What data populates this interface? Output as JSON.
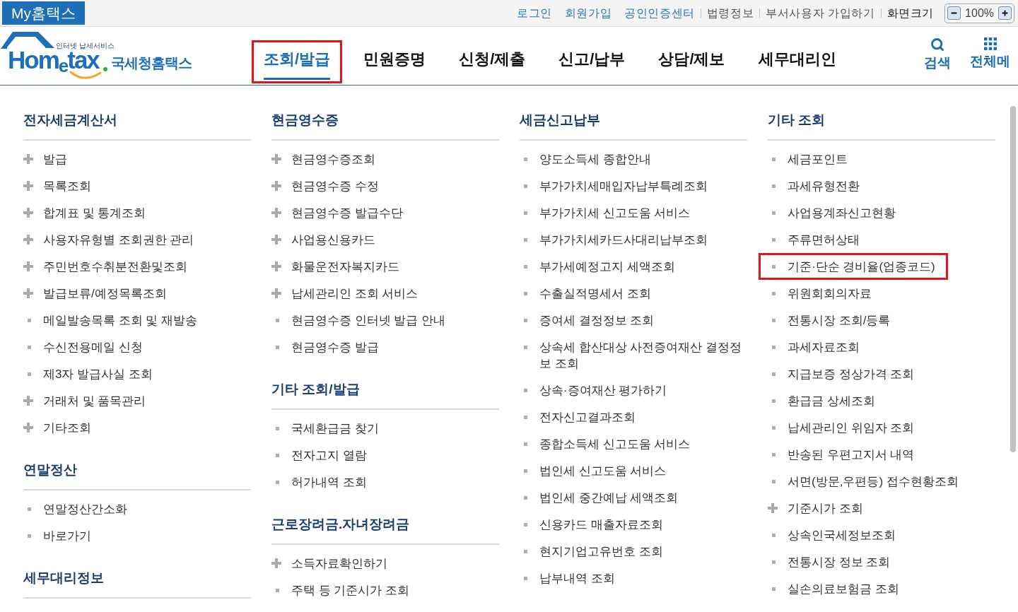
{
  "top_bar": {
    "brand": "My홈택스",
    "links": [
      {
        "label": "로그인",
        "kind": "primary"
      },
      {
        "label": "회원가입",
        "kind": "primary"
      },
      {
        "label": "공인인증센터",
        "kind": "primary"
      },
      {
        "label": "법령정보",
        "kind": "secondary"
      },
      {
        "label": "부서사용자 가입하기",
        "kind": "secondary"
      },
      {
        "label": "화면크기",
        "kind": "label"
      }
    ],
    "zoom_level": "100%"
  },
  "header": {
    "logo": {
      "tagline": "인터넷 납세서비스",
      "wordmark": "Hom$_{e}$tax",
      "title": "국세청홈택스"
    },
    "nav": [
      {
        "label": "조회/발급",
        "selected": true,
        "highlighted": true
      },
      {
        "label": "민원증명",
        "selected": false,
        "highlighted": false
      },
      {
        "label": "신청/제출",
        "selected": false,
        "highlighted": false
      },
      {
        "label": "신고/납부",
        "selected": false,
        "highlighted": false
      },
      {
        "label": "상담/제보",
        "selected": false,
        "highlighted": false
      },
      {
        "label": "세무대리인",
        "selected": false,
        "highlighted": false
      }
    ],
    "tools": [
      {
        "label": "검색",
        "kind": "search"
      },
      {
        "label": "전체메",
        "kind": "menu"
      }
    ]
  },
  "menu": {
    "columns": [
      {
        "sections": [
          {
            "title": "전자세금계산서",
            "items": [
              {
                "label": "발급",
                "kind": "expand",
                "highlighted": false
              },
              {
                "label": "목록조회",
                "kind": "expand",
                "highlighted": false
              },
              {
                "label": "합계표 및 통계조회",
                "kind": "expand",
                "highlighted": false
              },
              {
                "label": "사용자유형별 조회권한 관리",
                "kind": "expand",
                "highlighted": false
              },
              {
                "label": "주민번호수취분전환및조회",
                "kind": "expand",
                "highlighted": false
              },
              {
                "label": "발급보류/예정목록조회",
                "kind": "expand",
                "highlighted": false
              },
              {
                "label": "메일발송목록 조회 및 재발송",
                "kind": "link",
                "highlighted": false
              },
              {
                "label": "수신전용메일 신청",
                "kind": "link",
                "highlighted": false
              },
              {
                "label": "제3자 발급사실 조회",
                "kind": "link",
                "highlighted": false
              },
              {
                "label": "거래처 및 품목관리",
                "kind": "expand",
                "highlighted": false
              },
              {
                "label": "기타조회",
                "kind": "expand",
                "highlighted": false
              }
            ]
          },
          {
            "title": "연말정산",
            "items": [
              {
                "label": "연말정산간소화",
                "kind": "link",
                "highlighted": false
              },
              {
                "label": "바로가기",
                "kind": "link",
                "highlighted": false
              }
            ]
          },
          {
            "title": "세무대리정보"
          }
        ]
      },
      {
        "sections": [
          {
            "title": "현금영수증",
            "items": [
              {
                "label": "현금영수증조회",
                "kind": "expand",
                "highlighted": false
              },
              {
                "label": "현금영수증 수정",
                "kind": "expand",
                "highlighted": false
              },
              {
                "label": "현금영수증 발급수단",
                "kind": "expand",
                "highlighted": false
              },
              {
                "label": "사업용신용카드",
                "kind": "expand",
                "highlighted": false
              },
              {
                "label": "화물운전자복지카드",
                "kind": "expand",
                "highlighted": false
              },
              {
                "label": "납세관리인 조회 서비스",
                "kind": "expand",
                "highlighted": false
              },
              {
                "label": "현금영수증 인터넷 발급 안내",
                "kind": "link",
                "highlighted": false
              },
              {
                "label": "현금영수증 발급",
                "kind": "link",
                "highlighted": false
              }
            ]
          },
          {
            "title": "기타 조회/발급",
            "items": [
              {
                "label": "국세환급금 찾기",
                "kind": "link",
                "highlighted": false
              },
              {
                "label": "전자고지 열람",
                "kind": "link",
                "highlighted": false
              },
              {
                "label": "허가내역 조회",
                "kind": "link",
                "highlighted": false
              }
            ]
          },
          {
            "title": "근로장려금.자녀장려금",
            "items": [
              {
                "label": "소득자료확인하기",
                "kind": "expand",
                "highlighted": false
              },
              {
                "label": "주택 등 기준시가 조회",
                "kind": "link",
                "highlighted": false
              }
            ]
          }
        ]
      },
      {
        "sections": [
          {
            "title": "세금신고납부",
            "items": [
              {
                "label": "양도소득세 종합안내",
                "kind": "link",
                "highlighted": false
              },
              {
                "label": "부가가치세매입자납부특례조회",
                "kind": "link",
                "highlighted": false
              },
              {
                "label": "부가가치세 신고도움 서비스",
                "kind": "link",
                "highlighted": false
              },
              {
                "label": "부가가치세카드사대리납부조회",
                "kind": "link",
                "highlighted": false
              },
              {
                "label": "부가세예정고지 세액조회",
                "kind": "link",
                "highlighted": false
              },
              {
                "label": "수출실적명세서 조회",
                "kind": "link",
                "highlighted": false
              },
              {
                "label": "증여세 결정정보 조회",
                "kind": "link",
                "highlighted": false
              },
              {
                "label": "상속세 합산대상 사전증여재산 결정정보 조회",
                "kind": "link",
                "highlighted": false
              },
              {
                "label": "상속·증여재산 평가하기",
                "kind": "link",
                "highlighted": false
              },
              {
                "label": "전자신고결과조회",
                "kind": "link",
                "highlighted": false
              },
              {
                "label": "종합소득세 신고도움 서비스",
                "kind": "link",
                "highlighted": false
              },
              {
                "label": "법인세 신고도움 서비스",
                "kind": "link",
                "highlighted": false
              },
              {
                "label": "법인세 중간예납 세액조회",
                "kind": "link",
                "highlighted": false
              },
              {
                "label": "신용카드 매출자료조회",
                "kind": "link",
                "highlighted": false
              },
              {
                "label": "현지기업고유번호 조회",
                "kind": "link",
                "highlighted": false
              },
              {
                "label": "납부내역 조회",
                "kind": "link",
                "highlighted": false
              }
            ]
          }
        ]
      },
      {
        "sections": [
          {
            "title": "기타 조회",
            "items": [
              {
                "label": "세금포인트",
                "kind": "link",
                "highlighted": false
              },
              {
                "label": "과세유형전환",
                "kind": "link",
                "highlighted": false
              },
              {
                "label": "사업용계좌신고현황",
                "kind": "link",
                "highlighted": false
              },
              {
                "label": "주류면허상태",
                "kind": "link",
                "highlighted": false
              },
              {
                "label": "기준·단순 경비율(업종코드)",
                "kind": "link",
                "highlighted": true
              },
              {
                "label": "위원회회의자료",
                "kind": "link",
                "highlighted": false
              },
              {
                "label": "전통시장 조회/등록",
                "kind": "link",
                "highlighted": false
              },
              {
                "label": "과세자료조회",
                "kind": "link",
                "highlighted": false
              },
              {
                "label": "지급보증 정상가격 조회",
                "kind": "link",
                "highlighted": false
              },
              {
                "label": "환급금 상세조회",
                "kind": "link",
                "highlighted": false
              },
              {
                "label": "납세관리인 위임자 조회",
                "kind": "link",
                "highlighted": false
              },
              {
                "label": "반송된 우편고지서 내역",
                "kind": "link",
                "highlighted": false
              },
              {
                "label": "서면(방문,우편등) 접수현황조회",
                "kind": "link",
                "highlighted": false
              },
              {
                "label": "기준시가 조회",
                "kind": "expand",
                "highlighted": false
              },
              {
                "label": "상속인국세정보조회",
                "kind": "link",
                "highlighted": false
              },
              {
                "label": "전통시장 정보 조회",
                "kind": "link",
                "highlighted": false
              },
              {
                "label": "실손의료보험금 조회",
                "kind": "link",
                "highlighted": false
              }
            ]
          }
        ]
      }
    ]
  }
}
